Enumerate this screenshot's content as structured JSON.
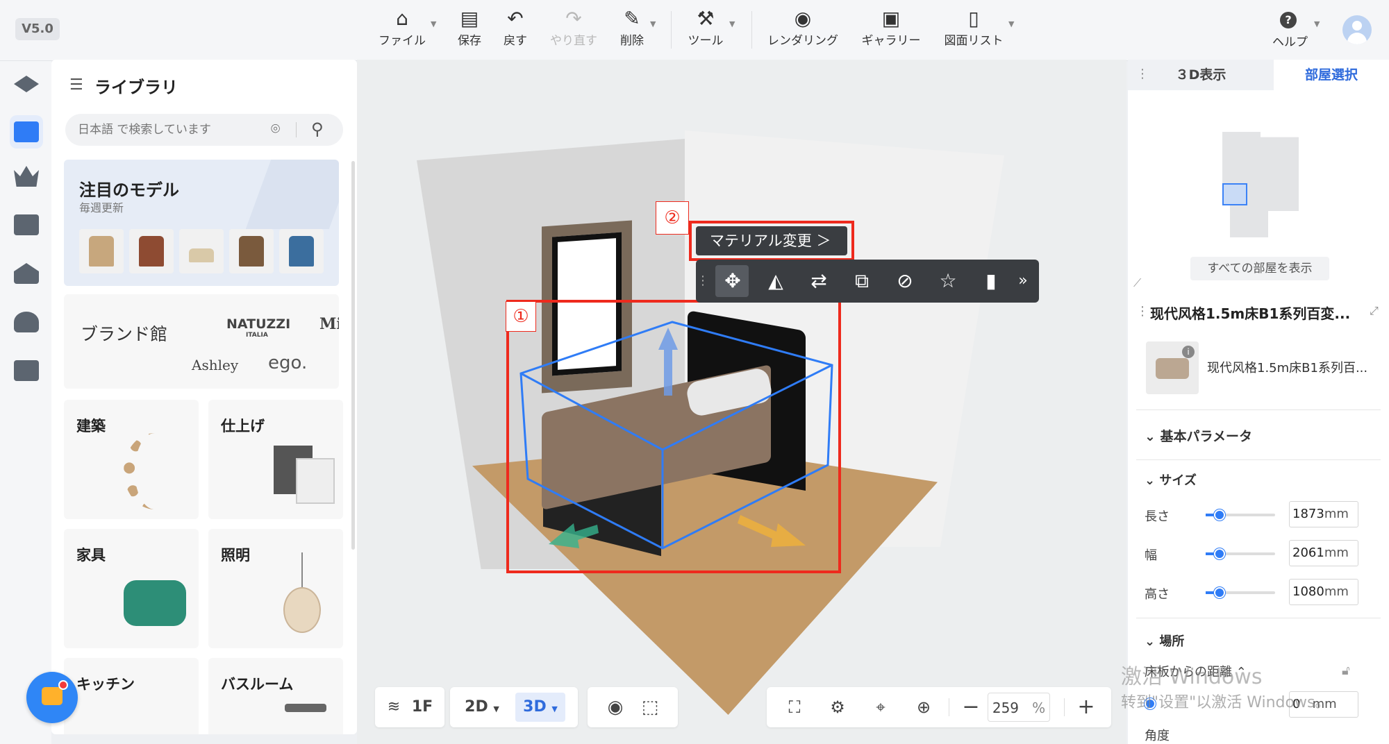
{
  "app": {
    "version": "V5.0"
  },
  "toolbar": {
    "file": "ファイル",
    "save": "保存",
    "undo": "戻す",
    "redo": "やり直す",
    "delete": "削除",
    "tools": "ツール",
    "render": "レンダリング",
    "gallery": "ギャラリー",
    "drawings": "図面リスト",
    "help": "ヘルプ"
  },
  "library": {
    "title": "ライブラリ",
    "search_placeholder": "日本語 で検索しています",
    "featured": {
      "title": "注目のモデル",
      "subtitle": "毎週更新"
    },
    "brand": {
      "title": "ブランド館",
      "logos": [
        "NATUZZI",
        "ITALIA",
        "Mi",
        "Ashley",
        "ego."
      ]
    },
    "categories": [
      "建築",
      "仕上げ",
      "家具",
      "照明",
      "キッチン",
      "バスルーム"
    ]
  },
  "viewport": {
    "annotation_1": "①",
    "annotation_2": "②",
    "material_change": "マテリアル変更 ＞"
  },
  "bottom": {
    "floor": "1F",
    "view_2d": "2D",
    "view_3d": "3D",
    "zoom_value": "259",
    "zoom_unit": "%"
  },
  "right_panel": {
    "tab_3d": "３D表示",
    "tab_room": "部屋選択",
    "show_all_rooms": "すべての部屋を表示"
  },
  "properties": {
    "title": "现代风格1.5m床B1系列百変...",
    "item_name": "现代风格1.5m床B1系列百...",
    "basic_params": "基本パラメータ",
    "size": "サイズ",
    "length_label": "長さ",
    "length_value": "1873",
    "width_label": "幅",
    "width_value": "2061",
    "height_label": "高さ",
    "height_value": "1080",
    "unit": "mm",
    "location": "場所",
    "floor_distance_label": "床板からの距離",
    "floor_distance_value": "0",
    "angle_label": "角度"
  },
  "watermark": {
    "line1": "激活 Windows",
    "line2": "转到\"设置\"以激活 Windows。"
  },
  "colors": {
    "accent": "#2f6bdc",
    "annotation": "#ee2a1d",
    "bbox": "#2f7cf6"
  }
}
